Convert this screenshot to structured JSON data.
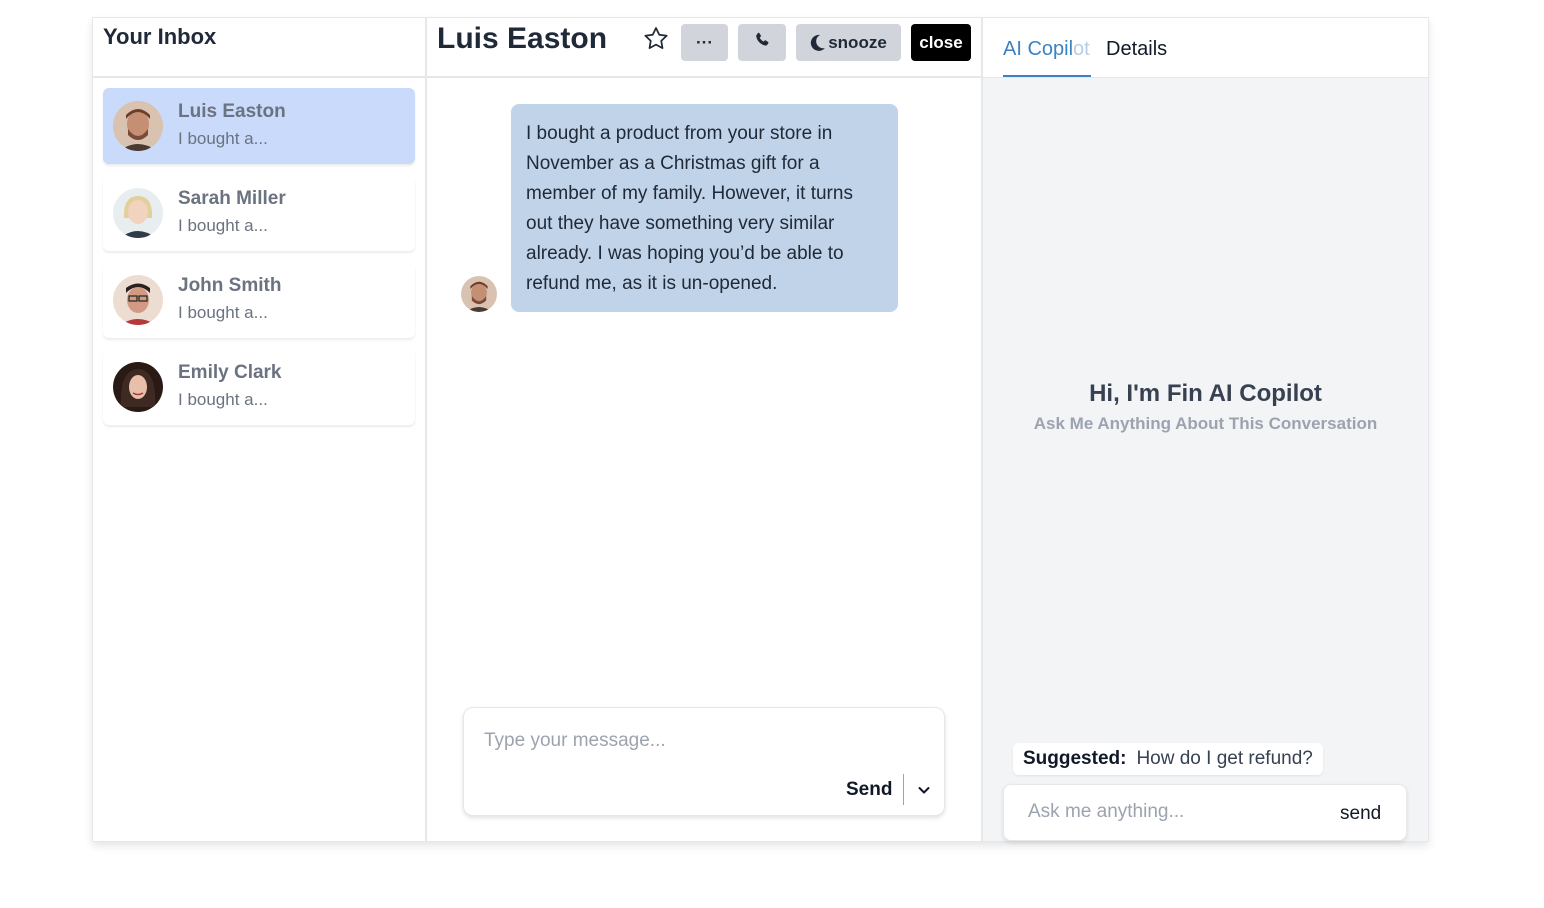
{
  "inbox": {
    "title": "Your Inbox",
    "conversations": [
      {
        "name": "Luis Easton",
        "preview": "I bought a...",
        "avatar_color": "#7a4a3a",
        "active": true
      },
      {
        "name": "Sarah Miller",
        "preview": "I bought a...",
        "avatar_color": "#d8c9a8",
        "active": false
      },
      {
        "name": "John Smith",
        "preview": "I bought a...",
        "avatar_color": "#c98f7a",
        "active": false
      },
      {
        "name": "Emily Clark",
        "preview": "I bought a...",
        "avatar_color": "#3a2622",
        "active": false
      }
    ]
  },
  "chat": {
    "title": "Luis Easton",
    "buttons": {
      "more": "···",
      "snooze": "snooze",
      "close": "close"
    },
    "messages": [
      {
        "text": "I bought a product from your store in November as a Christmas gift for a member of my family. However, it turns out they have something very similar already. I was hoping you’d be able to refund me, as it is un-opened."
      }
    ],
    "composer": {
      "placeholder": "Type your message...",
      "send_label": "Send"
    }
  },
  "copilot": {
    "tabs": {
      "copilot_main": "AI Copil",
      "copilot_fade": "ot",
      "details": "Details"
    },
    "title": "Hi, I'm Fin AI Copilot",
    "subtitle": "Ask Me Anything About This Conversation",
    "suggested_label": "Suggested:",
    "suggested_text": "How do I get refund?",
    "ask_placeholder": "Ask me anything...",
    "ask_send": "send"
  },
  "colors": {
    "active_item": "#c9dafb",
    "bubble": "#c1d3e8",
    "accent": "#3b82c4",
    "close_button": "#000000"
  }
}
